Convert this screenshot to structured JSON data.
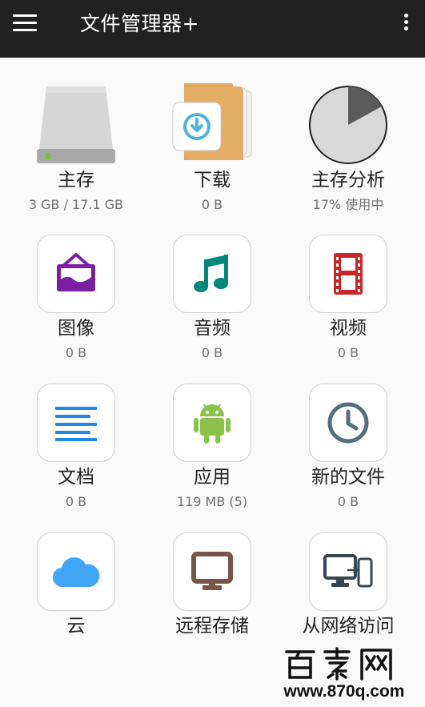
{
  "app_bar": {
    "title": "文件管理器+",
    "menu_icon": "hamburger-menu-icon",
    "overflow_icon": "more-vert-icon"
  },
  "tiles": [
    {
      "label": "主存",
      "sub": "3 GB / 17.1 GB",
      "icon": "hard-drive-icon"
    },
    {
      "label": "下载",
      "sub": "0 B",
      "icon": "download-folder-icon"
    },
    {
      "label": "主存分析",
      "sub": "17% 使用中",
      "icon": "pie-chart-icon",
      "used_fraction": 0.17
    },
    {
      "label": "图像",
      "sub": "0 B",
      "icon": "image-icon",
      "color": "#7b1fa2"
    },
    {
      "label": "音频",
      "sub": "0 B",
      "icon": "music-note-icon",
      "color": "#00897b"
    },
    {
      "label": "视频",
      "sub": "0 B",
      "icon": "film-strip-icon",
      "color": "#c62828"
    },
    {
      "label": "文档",
      "sub": "0 B",
      "icon": "text-document-icon",
      "color": "#1e88e5"
    },
    {
      "label": "应用",
      "sub": "119 MB (5)",
      "icon": "android-icon",
      "color": "#8bc34a"
    },
    {
      "label": "新的文件",
      "sub": "0 B",
      "icon": "clock-icon",
      "color": "#546e7a"
    },
    {
      "label": "云",
      "sub": "",
      "icon": "cloud-icon",
      "color": "#42a5f5"
    },
    {
      "label": "远程存储",
      "sub": "",
      "icon": "monitor-icon",
      "color": "#795548"
    },
    {
      "label": "从网络访问",
      "sub": "",
      "icon": "network-devices-icon",
      "color": "#37474f"
    }
  ],
  "watermark": {
    "logo_text": "百素网",
    "url": "www.870q.com"
  }
}
